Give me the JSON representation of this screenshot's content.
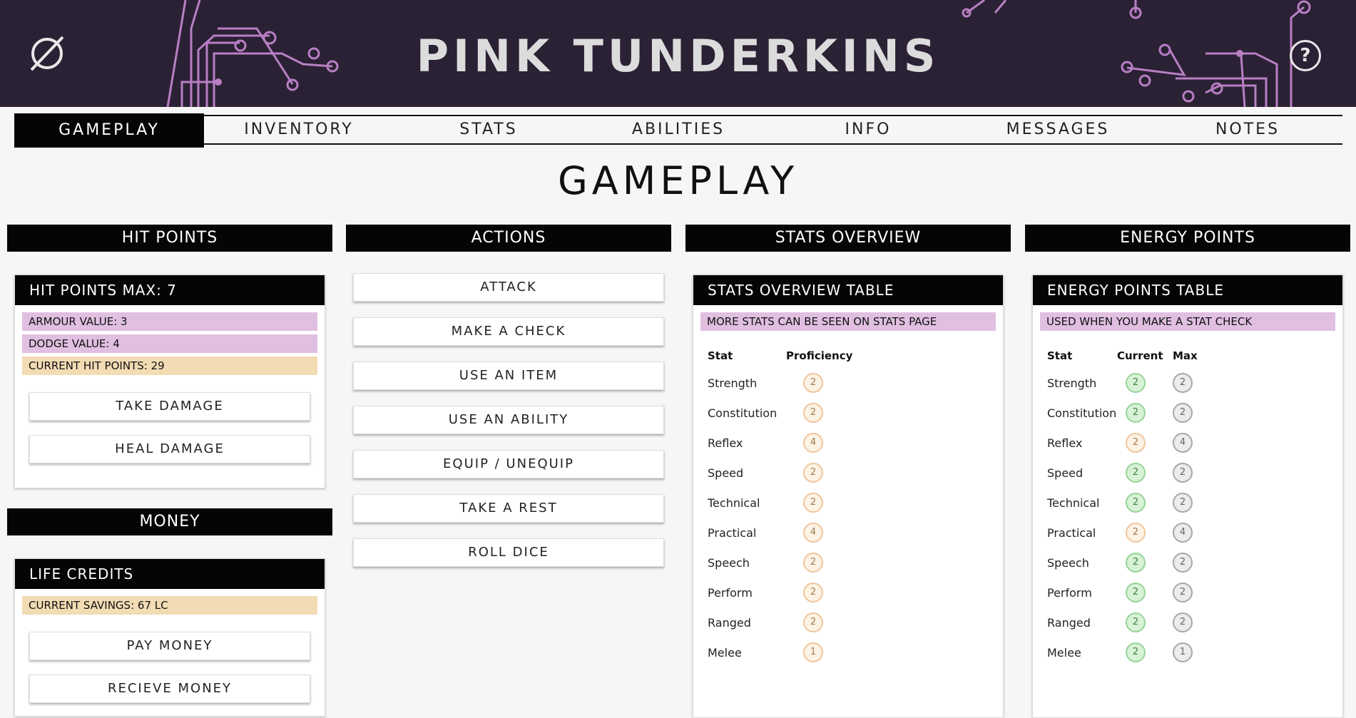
{
  "app": {
    "title": "PINK TUNDERKINS",
    "help_label": "?"
  },
  "nav": {
    "tabs": [
      "GAMEPLAY",
      "INVENTORY",
      "STATS",
      "ABILITIES",
      "INFO",
      "MESSAGES",
      "NOTES"
    ],
    "active": "GAMEPLAY"
  },
  "page_title": "GAMEPLAY",
  "hit_points": {
    "header": "HIT POINTS",
    "card_title": "HIT POINTS MAX: 7",
    "armour": "ARMOUR VALUE: 3",
    "dodge": "DODGE VALUE: 4",
    "current": "CURRENT HIT POINTS: 29",
    "take_damage": "TAKE DAMAGE",
    "heal_damage": "HEAL DAMAGE"
  },
  "money": {
    "header": "MONEY",
    "card_title": "LIFE CREDITS",
    "savings": "CURRENT SAVINGS: 67 LC",
    "pay": "PAY MONEY",
    "receive": "RECIEVE MONEY"
  },
  "actions": {
    "header": "ACTIONS",
    "buttons": [
      "ATTACK",
      "MAKE A CHECK",
      "USE AN ITEM",
      "USE AN ABILITY",
      "EQUIP / UNEQUIP",
      "TAKE A REST",
      "ROLL DICE"
    ]
  },
  "stats_overview": {
    "header": "STATS OVERVIEW",
    "card_title": "STATS OVERVIEW TABLE",
    "note": "MORE STATS CAN BE SEEN ON STATS PAGE",
    "col_stat": "Stat",
    "col_prof": "Proficiency",
    "rows": [
      {
        "stat": "Strength",
        "prof": "2"
      },
      {
        "stat": "Constitution",
        "prof": "2"
      },
      {
        "stat": "Reflex",
        "prof": "4"
      },
      {
        "stat": "Speed",
        "prof": "2"
      },
      {
        "stat": "Technical",
        "prof": "2"
      },
      {
        "stat": "Practical",
        "prof": "4"
      },
      {
        "stat": "Speech",
        "prof": "2"
      },
      {
        "stat": "Perform",
        "prof": "2"
      },
      {
        "stat": "Ranged",
        "prof": "2"
      },
      {
        "stat": "Melee",
        "prof": "1"
      }
    ]
  },
  "energy": {
    "header": "ENERGY POINTS",
    "card_title": "ENERGY POINTS TABLE",
    "note": "USED WHEN YOU MAKE A STAT CHECK",
    "col_stat": "Stat",
    "col_current": "Current",
    "col_max": "Max",
    "rows": [
      {
        "stat": "Strength",
        "current": "2",
        "max": "2",
        "status": "green"
      },
      {
        "stat": "Constitution",
        "current": "2",
        "max": "2",
        "status": "green"
      },
      {
        "stat": "Reflex",
        "current": "2",
        "max": "4",
        "status": "orange"
      },
      {
        "stat": "Speed",
        "current": "2",
        "max": "2",
        "status": "green"
      },
      {
        "stat": "Technical",
        "current": "2",
        "max": "2",
        "status": "green"
      },
      {
        "stat": "Practical",
        "current": "2",
        "max": "4",
        "status": "orange"
      },
      {
        "stat": "Speech",
        "current": "2",
        "max": "2",
        "status": "green"
      },
      {
        "stat": "Perform",
        "current": "2",
        "max": "2",
        "status": "green"
      },
      {
        "stat": "Ranged",
        "current": "2",
        "max": "2",
        "status": "green"
      },
      {
        "stat": "Melee",
        "current": "2",
        "max": "1",
        "status": "green"
      }
    ]
  },
  "colors": {
    "header_bg": "#2b2134",
    "circuit": "#b87fc4",
    "pink_bar": "#e0bfe1",
    "tan_bar": "#f2dcb4"
  },
  "icons": {
    "logo": "empty-set-icon",
    "help": "question-circle-icon"
  }
}
